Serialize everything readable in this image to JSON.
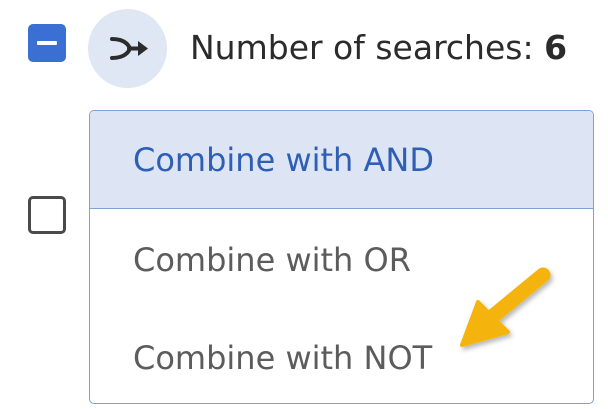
{
  "header": {
    "count_label": "Number of searches:",
    "count_value": "6",
    "icon": "merge-arrow-icon"
  },
  "menu": {
    "items": [
      {
        "label": "Combine with AND",
        "selected": true
      },
      {
        "label": "Combine with OR",
        "selected": false
      },
      {
        "label": "Combine with NOT",
        "selected": false
      }
    ]
  },
  "colors": {
    "accent": "#3b6fd3",
    "selected_bg": "#dde5f5",
    "selected_text": "#2f5fb5",
    "menu_border": "#7f9fd6",
    "annotation_arrow": "#f5b40f"
  }
}
